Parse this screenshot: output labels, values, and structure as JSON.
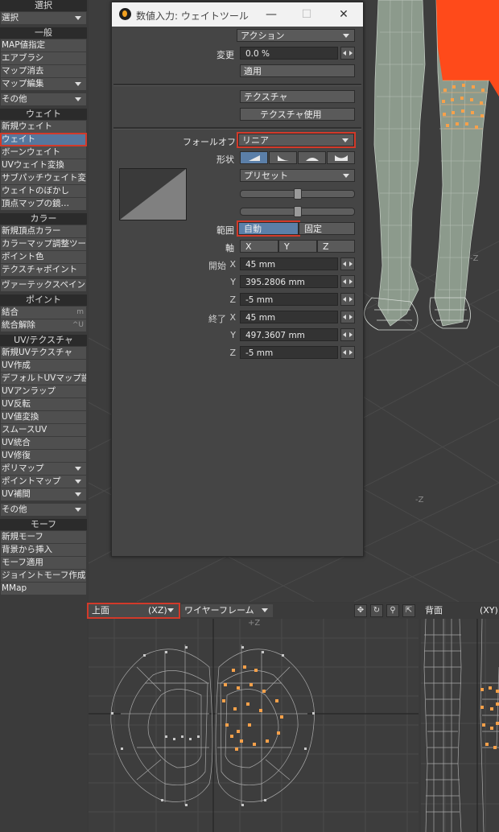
{
  "left_panel": {
    "groups": [
      {
        "title": "選択",
        "items": [
          {
            "label": "選択",
            "dropdown": true
          }
        ]
      },
      {
        "title": "一般",
        "items": [
          {
            "label": "MAP値指定"
          },
          {
            "label": "エアブラシ"
          },
          {
            "label": "マップ消去"
          },
          {
            "label": "マップ編集",
            "dropdown": true
          },
          {
            "label": "その他",
            "dropdown": true,
            "separate": true
          }
        ]
      },
      {
        "title": "ウェイト",
        "items": [
          {
            "label": "新規ウェイト"
          },
          {
            "label": "ウェイト",
            "active": true
          },
          {
            "label": "ボーンウェイト"
          },
          {
            "label": "UVウェイト変換"
          },
          {
            "label": "サブパッチウェイト変換"
          },
          {
            "label": "ウェイトのぼかし"
          },
          {
            "label": "頂点マップの鏡…"
          }
        ]
      },
      {
        "title": "カラー",
        "items": [
          {
            "label": "新規頂点カラー"
          },
          {
            "label": "カラーマップ調整ツール"
          },
          {
            "label": "ポイント色"
          },
          {
            "label": "テクスチャポイント"
          },
          {
            "label": "ヴァーテックスペイント",
            "separate": true
          }
        ]
      },
      {
        "title": "ポイント",
        "items": [
          {
            "label": "結合",
            "key": "m"
          },
          {
            "label": "統合解除",
            "key": "^U"
          }
        ]
      },
      {
        "title": "UV/テクスチャ",
        "items": [
          {
            "label": "新規UVテクスチャ"
          },
          {
            "label": "UV作成"
          },
          {
            "label": "デフォルトUVマップ設定"
          },
          {
            "label": "UVアンラップ"
          },
          {
            "label": "UV反転"
          },
          {
            "label": "UV値変換"
          },
          {
            "label": "スムースUV"
          },
          {
            "label": "UV統合"
          },
          {
            "label": "UV修復"
          },
          {
            "label": "ポリマップ",
            "dropdown": true
          },
          {
            "label": "ポイントマップ",
            "dropdown": true
          },
          {
            "label": "UV補間",
            "dropdown": true
          },
          {
            "label": "その他",
            "dropdown": true,
            "separate": true
          }
        ]
      },
      {
        "title": "モーフ",
        "items": [
          {
            "label": "新規モーフ"
          },
          {
            "label": "背景から挿入"
          },
          {
            "label": "モーフ適用"
          },
          {
            "label": "ジョイントモーフ作成"
          },
          {
            "label": "MMap"
          }
        ]
      }
    ]
  },
  "dialog": {
    "title": "数値入力: ウェイトツール",
    "action_label": "アクション",
    "change_label": "変更",
    "change_value": "0.0 %",
    "apply_label": "適用",
    "texture_label": "テクスチャ",
    "use_texture_label": "テクスチャ使用",
    "falloff_label": "フォールオフ",
    "falloff_value": "リニア",
    "shape_label": "形状",
    "preset_label": "プリセット",
    "range_label": "範囲",
    "range_auto": "自動",
    "range_fixed": "固定",
    "axis_label": "軸",
    "axis_x": "X",
    "axis_y": "Y",
    "axis_z": "Z",
    "start_label": "開始",
    "end_label": "終了",
    "start": {
      "x_label": "X",
      "x": "45 mm",
      "y_label": "Y",
      "y": "395.2806 mm",
      "z_label": "Z",
      "z": "-5 mm"
    },
    "end": {
      "x_label": "X",
      "x": "45 mm",
      "y_label": "Y",
      "y": "497.3607 mm",
      "z_label": "Z",
      "z": "-5 mm"
    }
  },
  "viewports": {
    "top_view_label": "上面",
    "top_view_axes": "(XZ)",
    "render_mode": "ワイヤーフレーム",
    "back_view_label": "背面",
    "back_view_axes": "(XY)",
    "persp_axis_z1": "-Z",
    "persp_axis_z2": "-Z",
    "top_axis_label": "+Z"
  },
  "colors": {
    "accent_selected": "#5b7fa8",
    "highlight_red": "#d23a2a",
    "weight_orange": "#f7a14a"
  },
  "icons": {
    "move_view": "move-icon",
    "rotate_view": "rotate-icon",
    "zoom_view": "zoom-icon",
    "maximize_view": "maximize-icon"
  }
}
